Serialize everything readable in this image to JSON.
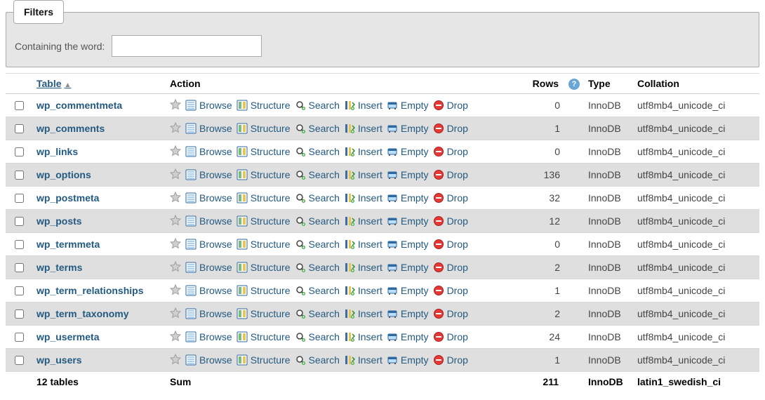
{
  "filters": {
    "legend": "Filters",
    "containing_label": "Containing the word:",
    "containing_value": ""
  },
  "header": {
    "table": "Table",
    "action": "Action",
    "rows": "Rows",
    "type": "Type",
    "collation": "Collation"
  },
  "actions": {
    "browse": "Browse",
    "structure": "Structure",
    "search": "Search",
    "insert": "Insert",
    "empty": "Empty",
    "drop": "Drop"
  },
  "tables": [
    {
      "name": "wp_commentmeta",
      "rows": 0,
      "approx": false,
      "type": "InnoDB",
      "collation": "utf8mb4_unicode_ci"
    },
    {
      "name": "wp_comments",
      "rows": 1,
      "approx": false,
      "type": "InnoDB",
      "collation": "utf8mb4_unicode_ci"
    },
    {
      "name": "wp_links",
      "rows": 0,
      "approx": false,
      "type": "InnoDB",
      "collation": "utf8mb4_unicode_ci"
    },
    {
      "name": "wp_options",
      "rows": 136,
      "approx": true,
      "type": "InnoDB",
      "collation": "utf8mb4_unicode_ci"
    },
    {
      "name": "wp_postmeta",
      "rows": 32,
      "approx": true,
      "type": "InnoDB",
      "collation": "utf8mb4_unicode_ci"
    },
    {
      "name": "wp_posts",
      "rows": 12,
      "approx": true,
      "type": "InnoDB",
      "collation": "utf8mb4_unicode_ci"
    },
    {
      "name": "wp_termmeta",
      "rows": 0,
      "approx": false,
      "type": "InnoDB",
      "collation": "utf8mb4_unicode_ci"
    },
    {
      "name": "wp_terms",
      "rows": 2,
      "approx": true,
      "type": "InnoDB",
      "collation": "utf8mb4_unicode_ci"
    },
    {
      "name": "wp_term_relationships",
      "rows": 1,
      "approx": false,
      "type": "InnoDB",
      "collation": "utf8mb4_unicode_ci"
    },
    {
      "name": "wp_term_taxonomy",
      "rows": 2,
      "approx": true,
      "type": "InnoDB",
      "collation": "utf8mb4_unicode_ci"
    },
    {
      "name": "wp_usermeta",
      "rows": 24,
      "approx": true,
      "type": "InnoDB",
      "collation": "utf8mb4_unicode_ci"
    },
    {
      "name": "wp_users",
      "rows": 1,
      "approx": false,
      "type": "InnoDB",
      "collation": "utf8mb4_unicode_ci"
    }
  ],
  "summary": {
    "count_label": "12 tables",
    "sum_label": "Sum",
    "rows_sum": "211",
    "type": "InnoDB",
    "collation": "latin1_swedish_ci"
  }
}
